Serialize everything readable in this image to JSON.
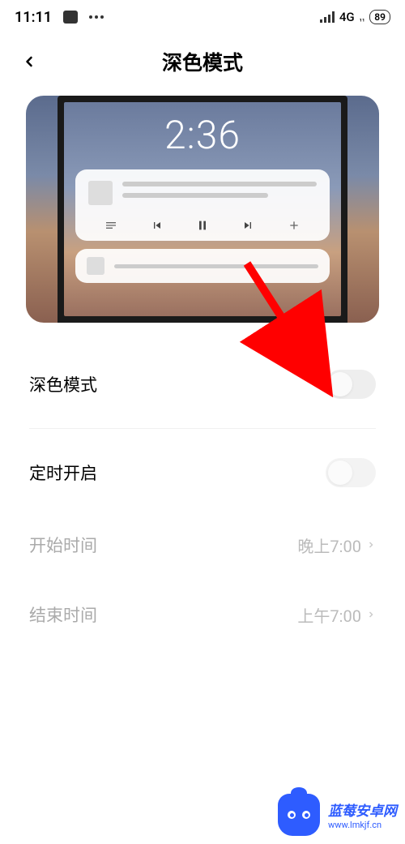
{
  "status_bar": {
    "time": "11:11",
    "network_type": "4G",
    "network_sub": "₁₁",
    "battery": "89"
  },
  "header": {
    "title": "深色模式"
  },
  "preview": {
    "time": "2:36"
  },
  "settings": {
    "dark_mode": {
      "label": "深色模式",
      "enabled": false
    },
    "scheduled": {
      "label": "定时开启",
      "enabled": false
    },
    "start_time": {
      "label": "开始时间",
      "value": "晚上7:00"
    },
    "end_time": {
      "label": "结束时间",
      "value": "上午7:00"
    }
  },
  "watermark": {
    "title": "蓝莓安卓网",
    "url": "www.lmkjf.cn"
  }
}
